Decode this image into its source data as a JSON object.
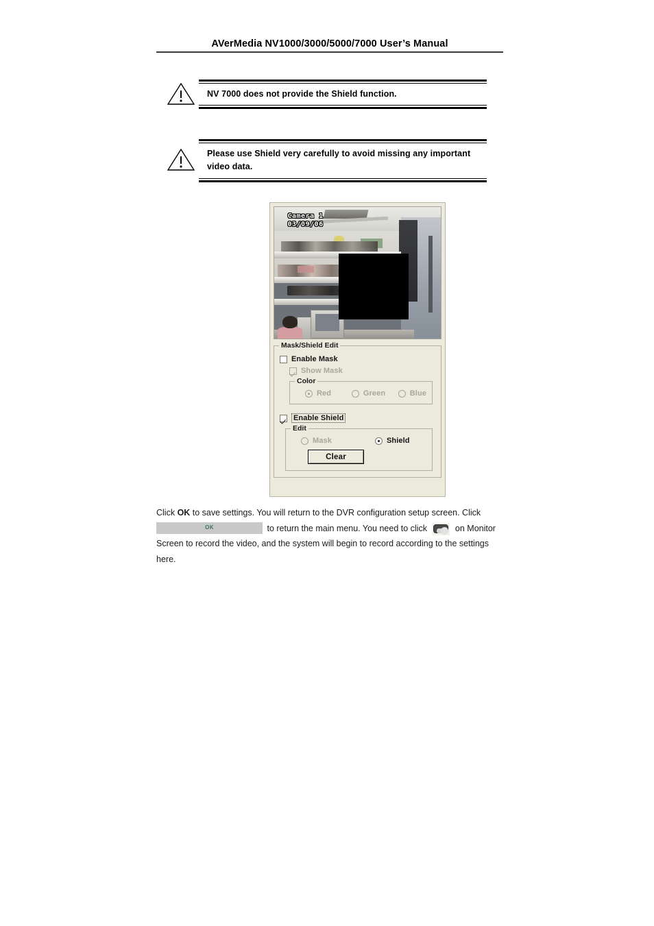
{
  "header": {
    "title": "AVerMedia NV1000/3000/5000/7000 User’s Manual"
  },
  "notes": [
    {
      "icon": "warning-triangle-icon",
      "text": "NV 7000 does not provide the Shield function."
    },
    {
      "icon": "warning-triangle-icon",
      "text": "Please use Shield very carefully to avoid missing any important video data."
    }
  ],
  "dialog": {
    "video": {
      "osd_camera": "Camera 1",
      "osd_date": "03/09/06",
      "shield_overlay_color": "#000000"
    },
    "mask_shield_group": {
      "title": "Mask/Shield Edit",
      "enable_mask": {
        "label": "Enable Mask",
        "checked": false,
        "enabled": true
      },
      "show_mask": {
        "label": "Show Mask",
        "checked": true,
        "enabled": false
      },
      "color_group": {
        "title": "Color",
        "enabled": false,
        "options": [
          {
            "label": "Red",
            "selected": true
          },
          {
            "label": "Green",
            "selected": false
          },
          {
            "label": "Blue",
            "selected": false
          }
        ]
      },
      "enable_shield": {
        "label": "Enable Shield",
        "checked": true,
        "enabled": true,
        "focused": true
      },
      "edit_group": {
        "title": "Edit",
        "options": [
          {
            "label": "Mask",
            "selected": false,
            "enabled": false
          },
          {
            "label": "Shield",
            "selected": true,
            "enabled": true
          }
        ],
        "clear_button": "Clear"
      }
    }
  },
  "body": {
    "part1": "Click ",
    "ok_bold": "OK",
    "part2": " to save settings. You will return to the DVR configuration setup screen. Click ",
    "ok_button_label": "OK",
    "part3": " to return the main menu. You need to click ",
    "part4": " on Monitor Screen to record the video, and the system will begin to record according to the settings here."
  }
}
